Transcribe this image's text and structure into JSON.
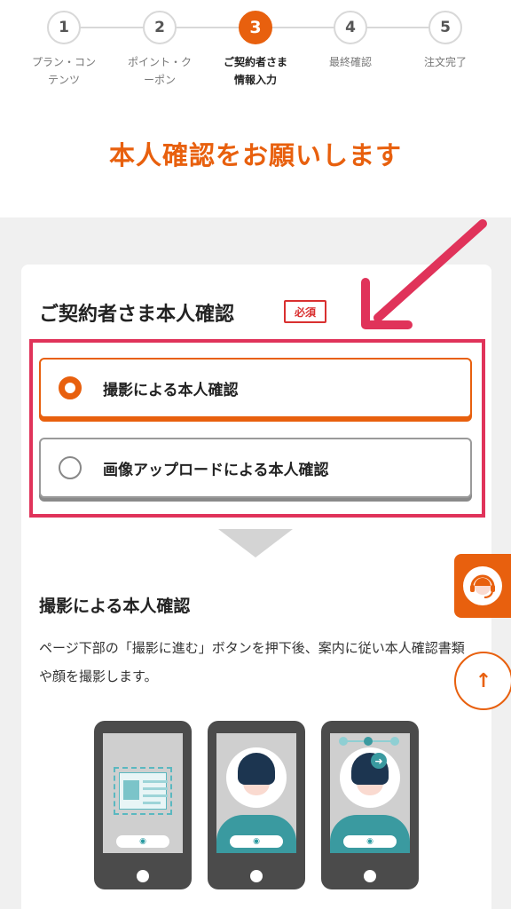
{
  "stepper": {
    "steps": [
      {
        "num": "1",
        "label": "プラン・コン\nテンツ"
      },
      {
        "num": "2",
        "label": "ポイント・ク\nーポン"
      },
      {
        "num": "3",
        "label": "ご契約者さま\n情報入力"
      },
      {
        "num": "4",
        "label": "最終確認"
      },
      {
        "num": "5",
        "label": "注文完了"
      }
    ],
    "active_step": 3
  },
  "page_title": "本人確認をお願いします",
  "card": {
    "title": "ご契約者さま本人確認",
    "required_badge": "必須",
    "options": [
      {
        "label": "撮影による本人確認",
        "selected": true
      },
      {
        "label": "画像アップロードによる本人確認",
        "selected": false
      }
    ]
  },
  "section": {
    "title": "撮影による本人確認",
    "description": "ページ下部の「撮影に進む」ボタンを押下後、案内に従い本人確認書類や顔を撮影します。"
  },
  "icons": {
    "support": "operator-headset-icon",
    "scroll_top": "arrow-up-icon",
    "annotation": "red-arrow-icon",
    "camera": "camera-icon"
  },
  "colors": {
    "accent": "#e8600e",
    "highlight": "#e0335a",
    "required": "#d93030",
    "teal": "#3a9aa0"
  }
}
